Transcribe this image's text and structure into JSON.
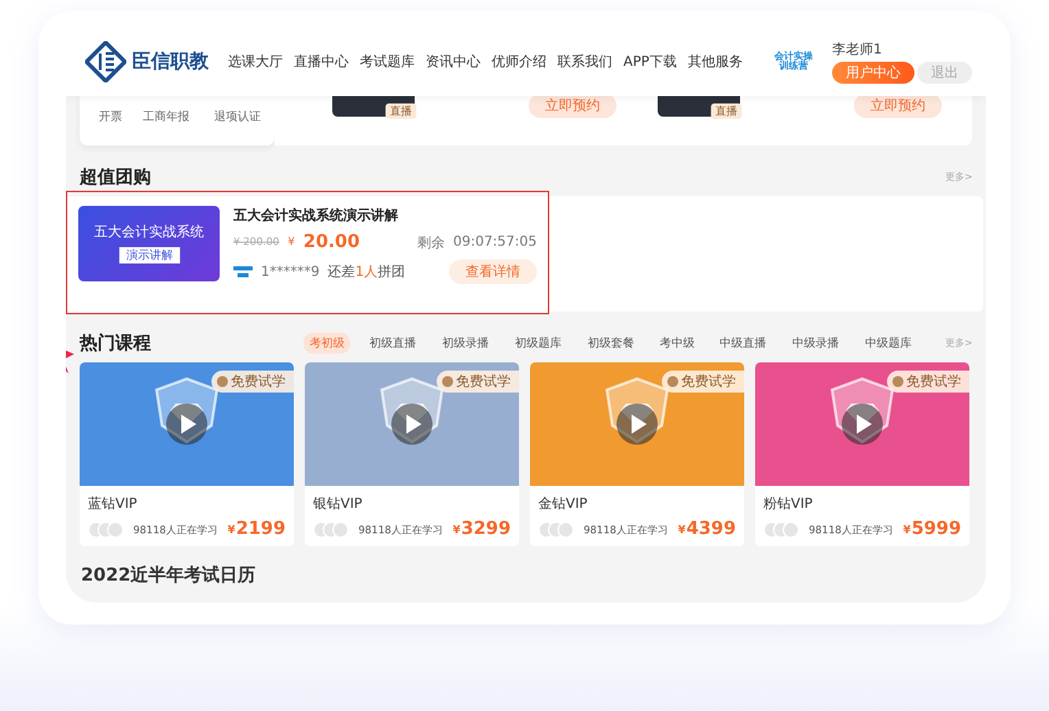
{
  "header": {
    "logo": "臣信职教",
    "nav": [
      "选课大厅",
      "直播中心",
      "考试题库",
      "资讯中心",
      "优师介绍",
      "联系我们",
      "APP下载",
      "其他服务"
    ],
    "badge": [
      "会计实操",
      "训练营"
    ],
    "user": "李老师1",
    "buttons": [
      {
        "label": "用户中心",
        "primary": true
      },
      {
        "label": "退出",
        "primary": false
      }
    ]
  },
  "top_strip": {
    "links": [
      "开票",
      "工商年报",
      "退项认证"
    ],
    "teachers": [
      {
        "tag": "直播",
        "button": "立即预约"
      },
      {
        "tag": "直播",
        "button": "立即预约"
      }
    ]
  },
  "group_buy": {
    "title": "超值团购",
    "more": "更多>",
    "deal": {
      "highlighted": true,
      "banner_title": "五大会计实战系统",
      "banner_sub": "演示讲解",
      "name": "五大会计实战系统演示讲解",
      "old_price": "¥ 200.00",
      "currency": "¥",
      "price": "20.00",
      "remain_label": "剩余",
      "countdown": "09:07:57:05",
      "buyer": "1******9",
      "need_prefix": "还差",
      "need_count": "1人",
      "need_suffix": "拼团",
      "button": "查看详情"
    }
  },
  "hot_courses": {
    "title": "热门课程",
    "more": "更多>",
    "tabs": [
      {
        "label": "考初级",
        "selected": true
      },
      {
        "label": "初级直播",
        "selected": false
      },
      {
        "label": "初级录播",
        "selected": false
      },
      {
        "label": "初级题库",
        "selected": false
      },
      {
        "label": "初级套餐",
        "selected": false
      },
      {
        "label": "考中级",
        "selected": false
      },
      {
        "label": "中级直播",
        "selected": false
      },
      {
        "label": "中级录播",
        "selected": false
      },
      {
        "label": "中级题库",
        "selected": false
      }
    ],
    "cards": [
      {
        "name": "蓝钻VIP",
        "color": "#4a8fe0",
        "trial": "免费试学",
        "learners": "98118人正在学习",
        "currency": "¥",
        "price": "2199"
      },
      {
        "name": "银钻VIP",
        "color": "#98aed0",
        "trial": "免费试学",
        "learners": "98118人正在学习",
        "currency": "¥",
        "price": "3299"
      },
      {
        "name": "金钻VIP",
        "color": "#f09a30",
        "trial": "免费试学",
        "learners": "98118人正在学习",
        "currency": "¥",
        "price": "4399"
      },
      {
        "name": "粉钻VIP",
        "color": "#e8508e",
        "trial": "免费试学",
        "learners": "98118人正在学习",
        "currency": "¥",
        "price": "5999"
      }
    ]
  },
  "calendar": {
    "title": "2022近半年考试日历"
  }
}
